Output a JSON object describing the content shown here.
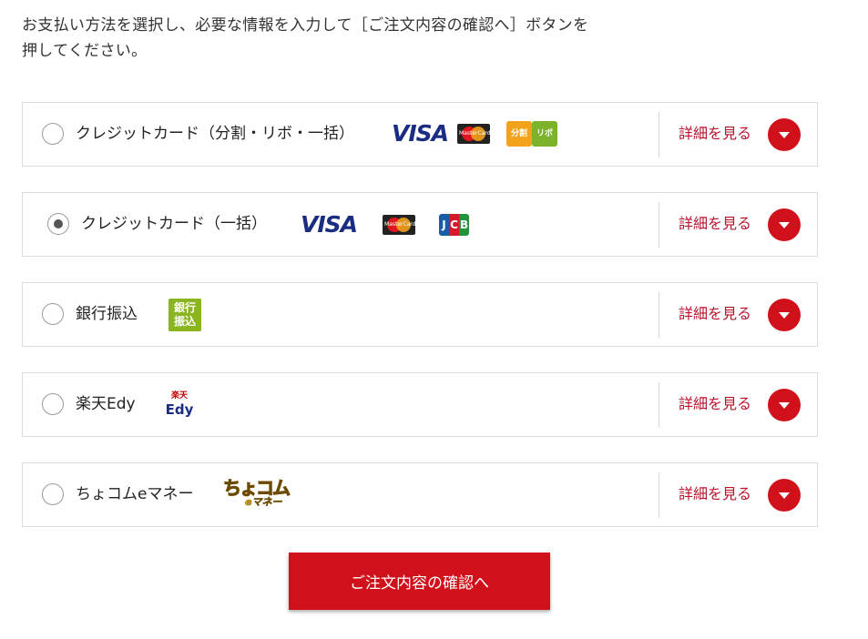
{
  "instruction": {
    "line1": "お支払い方法を選択し、必要な情報を入力して［ご注文内容の確認へ］ボタンを",
    "line2": "押してください。"
  },
  "methods": [
    {
      "label": "クレジットカード（分割・リボ・一括）",
      "checked": false,
      "detail_label": "詳細を見る",
      "logos": [
        "visa-logo",
        "mastercard-logo",
        "installment-badge",
        "revolving-badge"
      ]
    },
    {
      "label": "クレジットカード（一括）",
      "checked": true,
      "detail_label": "詳細を見る",
      "logos": [
        "visa-logo",
        "mastercard-logo",
        "jcb-logo"
      ]
    },
    {
      "label": "銀行振込",
      "checked": false,
      "detail_label": "詳細を見る",
      "logos": [
        "bank-transfer-logo"
      ]
    },
    {
      "label": "楽天Edy",
      "checked": false,
      "detail_label": "詳細を見る",
      "logos": [
        "rakuten-edy-logo"
      ]
    },
    {
      "label": "ちょコムeマネー",
      "checked": false,
      "detail_label": "詳細を見る",
      "logos": [
        "chocom-emoney-logo"
      ]
    }
  ],
  "logo_text": {
    "visa": "VISA",
    "mastercard": "MasterCard",
    "jcb": [
      "J",
      "C",
      "B"
    ],
    "installment": "分割",
    "revolving": "リボ",
    "bank": [
      "銀行",
      "振込"
    ],
    "edy_top": "楽天",
    "edy_bottom": "Edy",
    "chocom_main": "ちょコム",
    "chocom_sub": "eマネー"
  },
  "confirm_button": {
    "label": "ご注文内容の確認へ"
  },
  "colors": {
    "accent": "#d0111b",
    "link": "#b8122c",
    "visa": "#1a2d83",
    "bank": "#8bb51e"
  }
}
